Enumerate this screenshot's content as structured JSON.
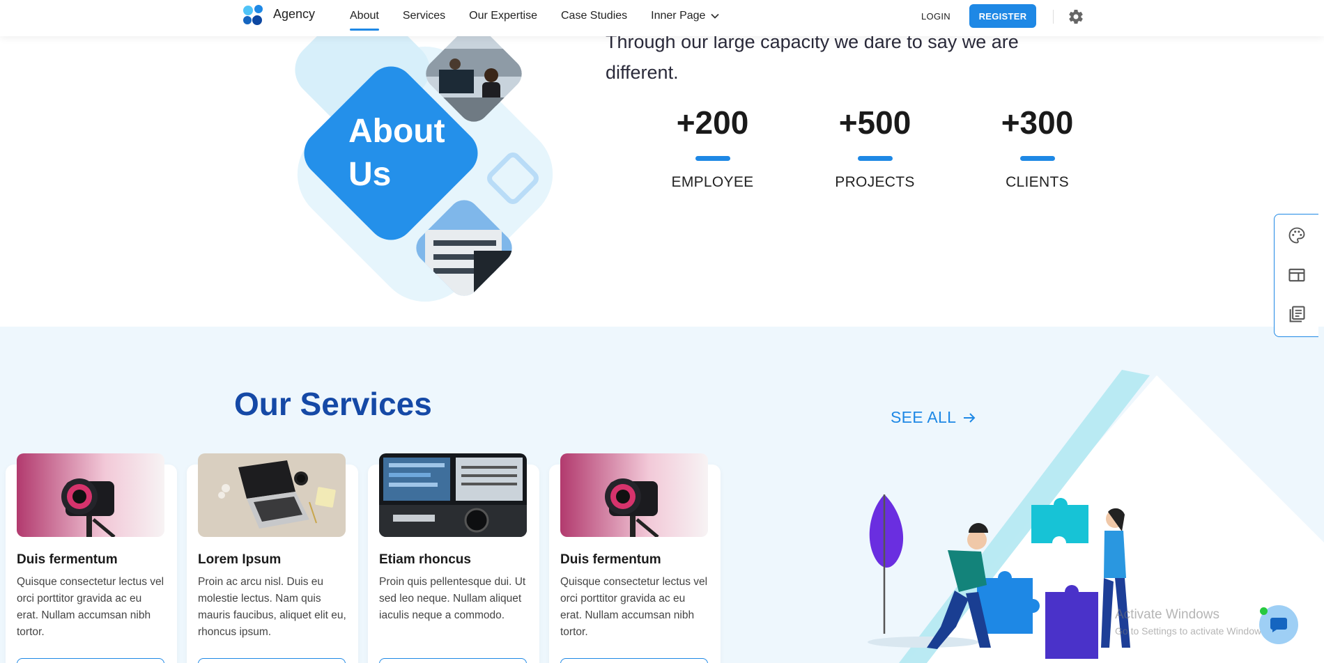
{
  "header": {
    "brand": "Agency",
    "nav": [
      {
        "label": "About"
      },
      {
        "label": "Services"
      },
      {
        "label": "Our Expertise"
      },
      {
        "label": "Case Studies"
      },
      {
        "label": "Inner Page"
      }
    ],
    "active_nav": "About",
    "login_label": "LOGIN",
    "register_label": "REGISTER"
  },
  "about": {
    "badge_title_line1": "About",
    "badge_title_line2": "Us",
    "heading_line1": "Through our large capacity we dare to say we are",
    "heading_line2": "different.",
    "stats": [
      {
        "value": "+200",
        "label": "EMPLOYEE"
      },
      {
        "value": "+500",
        "label": "PROJECTS"
      },
      {
        "value": "+300",
        "label": "CLIENTS"
      }
    ]
  },
  "services": {
    "title": "Our Services",
    "see_all": "SEE ALL",
    "cards": [
      {
        "title": "Duis fermentum",
        "desc": "Quisque consectetur lectus vel orci porttitor gravida ac eu erat. Nullam accumsan nibh tortor.",
        "image": "camera"
      },
      {
        "title": "Lorem Ipsum",
        "desc": "Proin ac arcu nisl. Duis eu molestie lectus. Nam quis mauris faucibus, aliquet elit eu, rhoncus ipsum.",
        "image": "laptop"
      },
      {
        "title": "Etiam rhoncus",
        "desc": "Proin quis pellentesque dui. Ut sed leo neque. Nullam aliquet iaculis neque a commodo.",
        "image": "audio-mixer"
      },
      {
        "title": "Duis fermentum",
        "desc": "Quisque consectetur lectus vel orci porttitor gravida ac eu erat. Nullam accumsan nibh tortor.",
        "image": "camera"
      }
    ]
  },
  "side_panel": {
    "icons": [
      "palette-icon",
      "layout-icon",
      "library-icon"
    ]
  },
  "os_overlay": {
    "line1": "Activate Windows",
    "line2": "Go to Settings to activate Windows."
  },
  "colors": {
    "accent": "#1e88e5",
    "services_title": "#1549a6",
    "services_bg": "#eef7fd"
  }
}
